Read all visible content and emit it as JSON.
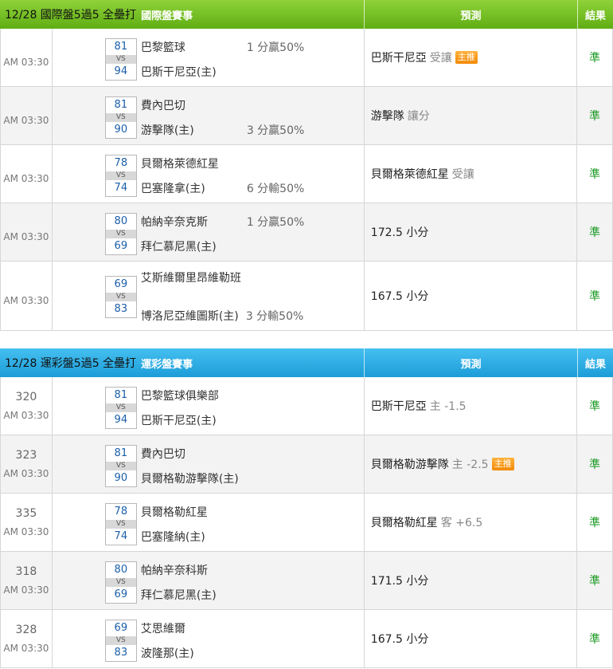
{
  "intl": {
    "title": "12/28 國際盤5過5 全壘打",
    "tag": "國際盤賽事",
    "pred_header": "預測",
    "result_header": "結果",
    "rows": [
      {
        "time": "AM 03:30",
        "score_a": "81",
        "vs": "VS",
        "score_b": "94",
        "team_a": "巴黎籃球",
        "team_b": "巴斯干尼亞(主)",
        "note": "1 分贏50%",
        "pred": "巴斯干尼亞",
        "pred_sub": "受讓",
        "badge": "主推",
        "result": "準"
      },
      {
        "time": "AM 03:30",
        "score_a": "81",
        "vs": "VS",
        "score_b": "90",
        "team_a": "費內巴切",
        "team_b": "游擊隊(主)",
        "note": "3 分贏50%",
        "pred": "游擊隊",
        "pred_sub": "讓分",
        "result": "準"
      },
      {
        "time": "AM 03:30",
        "score_a": "78",
        "vs": "VS",
        "score_b": "74",
        "team_a": "貝爾格萊德紅星",
        "team_b": "巴塞隆拿(主)",
        "note": "6 分輸50%",
        "pred": "貝爾格萊德紅星",
        "pred_sub": "受讓",
        "result": "準"
      },
      {
        "time": "AM 03:30",
        "score_a": "80",
        "vs": "VS",
        "score_b": "69",
        "team_a": "帕納辛奈克斯",
        "team_b": "拜仁慕尼黑(主)",
        "note": "1 分贏50%",
        "pred": "172.5 小分",
        "result": "準"
      },
      {
        "time": "AM 03:30",
        "score_a": "69",
        "vs": "VS",
        "score_b": "83",
        "team_a": "艾斯維爾里昂維勒班",
        "team_b": "博洛尼亞維圖斯(主)",
        "note": "3 分輸50%",
        "pred": "167.5 小分",
        "result": "準"
      }
    ]
  },
  "lott": {
    "title": "12/28 運彩盤5過5 全壘打",
    "tag": "運彩盤賽事",
    "pred_header": "預測",
    "result_header": "結果",
    "rows": [
      {
        "no": "320",
        "time": "AM 03:30",
        "score_a": "81",
        "vs": "VS",
        "score_b": "94",
        "team_a": "巴黎籃球俱樂部",
        "team_b": "巴斯干尼亞(主)",
        "pred": "巴斯干尼亞",
        "pred_sub": "主 -1.5",
        "result": "準"
      },
      {
        "no": "323",
        "time": "AM 03:30",
        "score_a": "81",
        "vs": "VS",
        "score_b": "90",
        "team_a": "費內巴切",
        "team_b": "貝爾格勒游擊隊(主)",
        "pred": "貝爾格勒游擊隊",
        "pred_sub": "主 -2.5",
        "badge": "主推",
        "result": "準"
      },
      {
        "no": "335",
        "time": "AM 03:30",
        "score_a": "78",
        "vs": "VS",
        "score_b": "74",
        "team_a": "貝爾格勒紅星",
        "team_b": "巴塞隆納(主)",
        "pred": "貝爾格勒紅星",
        "pred_sub": "客 +6.5",
        "result": "準"
      },
      {
        "no": "318",
        "time": "AM 03:30",
        "score_a": "80",
        "vs": "VS",
        "score_b": "69",
        "team_a": "帕納辛奈科斯",
        "team_b": "拜仁慕尼黑(主)",
        "pred": "171.5 小分",
        "result": "準"
      },
      {
        "no": "328",
        "time": "AM 03:30",
        "score_a": "69",
        "vs": "VS",
        "score_b": "83",
        "team_a": "艾思維爾",
        "team_b": "波隆那(主)",
        "pred": "167.5 小分",
        "result": "準"
      }
    ]
  }
}
